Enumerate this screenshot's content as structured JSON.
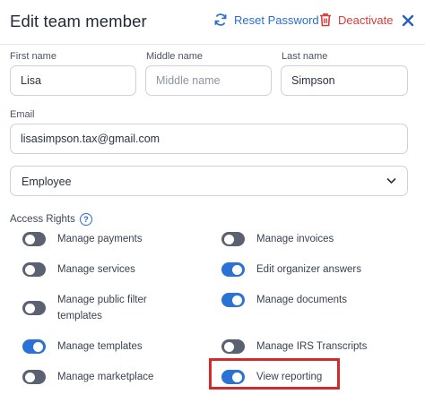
{
  "header": {
    "title": "Edit team member",
    "reset_password_label": "Reset Password",
    "deactivate_label": "Deactivate"
  },
  "form": {
    "first_name": {
      "label": "First name",
      "value": "Lisa",
      "placeholder": ""
    },
    "middle_name": {
      "label": "Middle name",
      "value": "",
      "placeholder": "Middle name"
    },
    "last_name": {
      "label": "Last name",
      "value": "Simpson",
      "placeholder": ""
    },
    "email": {
      "label": "Email",
      "value": "lisasimpson.tax@gmail.com",
      "placeholder": ""
    },
    "role": {
      "selected": "Employee"
    }
  },
  "access_rights": {
    "title": "Access Rights",
    "help_glyph": "?",
    "items": [
      {
        "label": "Manage payments",
        "enabled": false
      },
      {
        "label": "Manage invoices",
        "enabled": false
      },
      {
        "label": "Manage services",
        "enabled": false
      },
      {
        "label": "Edit organizer answers",
        "enabled": true
      },
      {
        "label": "Manage public filter templates",
        "enabled": false
      },
      {
        "label": "Manage documents",
        "enabled": true
      },
      {
        "label": "Manage templates",
        "enabled": true
      },
      {
        "label": "Manage IRS Transcripts",
        "enabled": false
      },
      {
        "label": "Manage marketplace",
        "enabled": false
      },
      {
        "label": "View reporting",
        "enabled": true
      }
    ]
  },
  "colors": {
    "accent": "#2a72d6",
    "danger": "#d93b3b",
    "toggle_off": "#5a6272",
    "highlight": "#d62a2a"
  }
}
